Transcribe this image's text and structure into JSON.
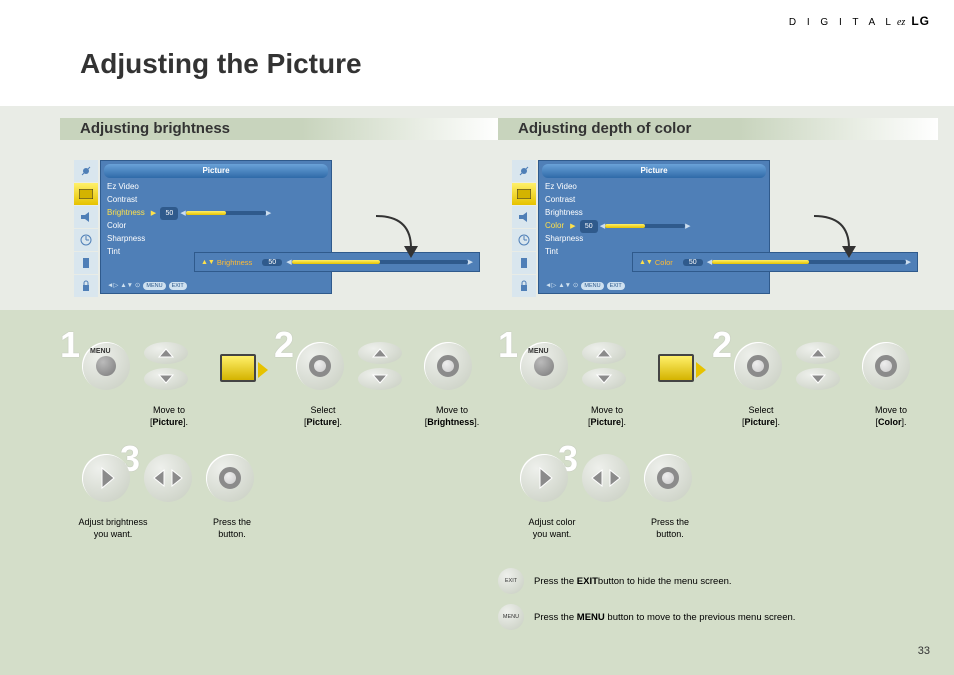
{
  "header": {
    "brand_letters": "D I G I T A L",
    "brand_ez": "ez",
    "brand_lg": "LG"
  },
  "page_title": "Adjusting the Picture",
  "page_number": "33",
  "left": {
    "heading": "Adjusting brightness",
    "osd": {
      "title": "Picture",
      "items": [
        "Ez Video",
        "Contrast",
        "Brightness",
        "Color",
        "Sharpness",
        "Tint"
      ],
      "selected_index": 2,
      "value": "50",
      "expand_label": "Brightness",
      "expand_value": "50",
      "foot_sym": "◄▷ ▲▼ ⊙",
      "foot_menu": "MENU",
      "foot_exit": "EXIT"
    },
    "steps": {
      "n1": "1",
      "n2": "2",
      "n3": "3",
      "menu_label": "MENU",
      "t1a": "Move to",
      "t1b": "Picture",
      "t2a": "Select",
      "t2b": "Picture",
      "t2c": "Move to",
      "t2d": "Brightness",
      "t3a": "Adjust brightness\nyou want.",
      "t3b": "Press the\nbutton."
    }
  },
  "right": {
    "heading": "Adjusting depth of color",
    "osd": {
      "title": "Picture",
      "items": [
        "Ez Video",
        "Contrast",
        "Brightness",
        "Color",
        "Sharpness",
        "Tint"
      ],
      "selected_index": 3,
      "value": "50",
      "expand_label": "Color",
      "expand_value": "50",
      "foot_sym": "◄▷ ▲▼ ⊙",
      "foot_menu": "MENU",
      "foot_exit": "EXIT"
    },
    "steps": {
      "n1": "1",
      "n2": "2",
      "n3": "3",
      "menu_label": "MENU",
      "t1a": "Move to",
      "t1b": "Picture",
      "t2a": "Select",
      "t2b": "Picture",
      "t2c": "Move to",
      "t2d": "Color",
      "t3a": "Adjust color\nyou want.",
      "t3b": "Press the\nbutton."
    }
  },
  "footnotes": {
    "exit_label": "EXIT",
    "exit_pre": "Press the ",
    "exit_bold": "EXIT",
    "exit_post": "button to hide the menu screen.",
    "menu_label": "MENU",
    "menu_pre": "Press the ",
    "menu_bold": "MENU",
    "menu_post": " button to move to the previous menu screen."
  }
}
